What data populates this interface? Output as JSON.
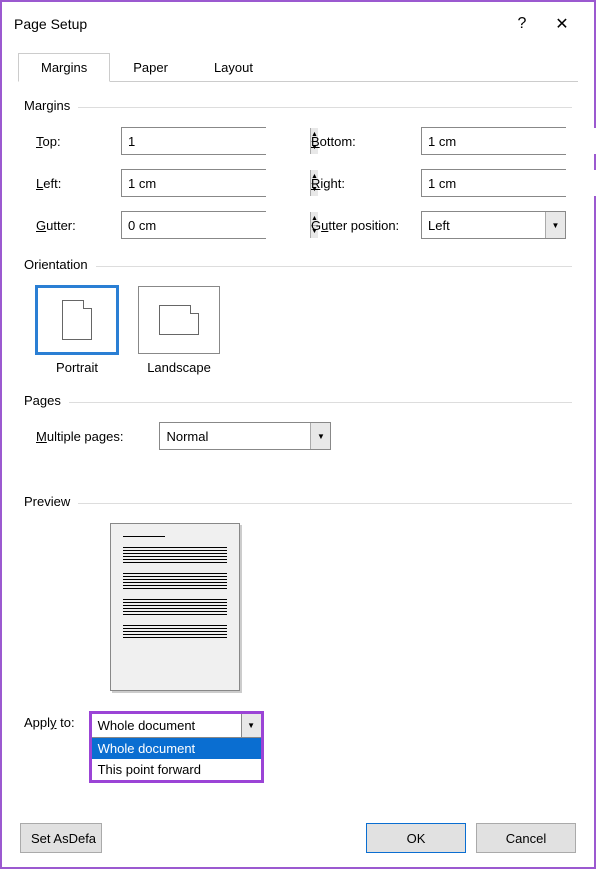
{
  "titlebar": {
    "title": "Page Setup",
    "help": "?",
    "close": "✕"
  },
  "tabs": {
    "margins": "Margins",
    "paper": "Paper",
    "layout": "Layout"
  },
  "sections": {
    "margins": "Margins",
    "orientation": "Orientation",
    "pages": "Pages",
    "preview": "Preview"
  },
  "fields": {
    "top": {
      "label": "Top:",
      "value": "1"
    },
    "bottom": {
      "label": "Bottom:",
      "value": "1 cm"
    },
    "left": {
      "label": "Left:",
      "value": "1 cm"
    },
    "right": {
      "label": "Right:",
      "value": "1 cm"
    },
    "gutter": {
      "label": "Gutter:",
      "value": "0 cm"
    },
    "gutterpos": {
      "label": "Gutter position:",
      "value": "Left"
    }
  },
  "orientation": {
    "portrait": "Portrait",
    "landscape": "Landscape"
  },
  "pages": {
    "multiple_label": "Multiple pages:",
    "value": "Normal"
  },
  "apply": {
    "label": "Apply to:",
    "selected": "Whole document",
    "options": [
      "Whole document",
      "This point forward"
    ]
  },
  "buttons": {
    "set_default": "Set As Default…",
    "ok": "OK",
    "cancel": "Cancel"
  }
}
